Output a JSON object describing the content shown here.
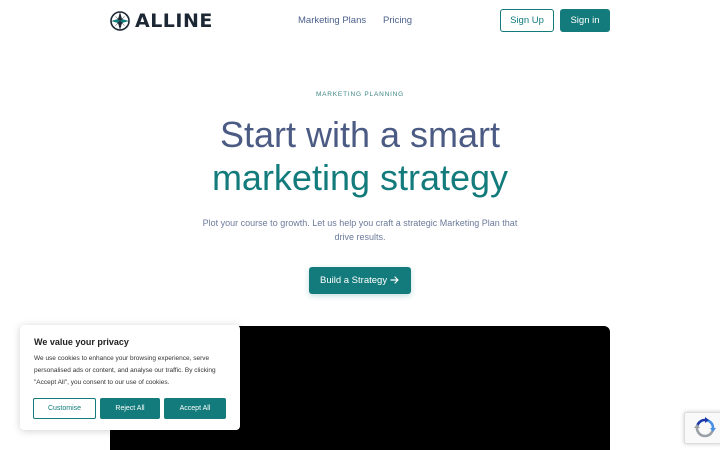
{
  "header": {
    "brand": "ALLINE",
    "nav": {
      "marketing_plans": "Marketing Plans",
      "pricing": "Pricing"
    },
    "sign_up": "Sign Up",
    "sign_in": "Sign in"
  },
  "hero": {
    "eyebrow": "MARKETING PLANNING",
    "headline_line1": "Start with a smart",
    "headline_line2": "marketing strategy",
    "subtext": "Plot your course to growth. Let us help you craft a strategic Marketing Plan that drive results.",
    "cta": "Build a Strategy"
  },
  "cookie_banner": {
    "title": "We value your privacy",
    "text": "We use cookies to enhance your browsing experience, serve personalised ads or content, and analyse our traffic. By clicking \"Accept All\", you consent to our use of cookies.",
    "customise": "Customise",
    "reject_all": "Reject All",
    "accept_all": "Accept All"
  },
  "icons": {
    "logo": "compass-star-logo-icon",
    "cta_arrow": "arrow-right-icon",
    "recaptcha": "recaptcha-icon"
  },
  "colors": {
    "brand_teal": "#137b7b",
    "headline_slate": "#4b5b83",
    "dark_text": "#1d2733"
  }
}
